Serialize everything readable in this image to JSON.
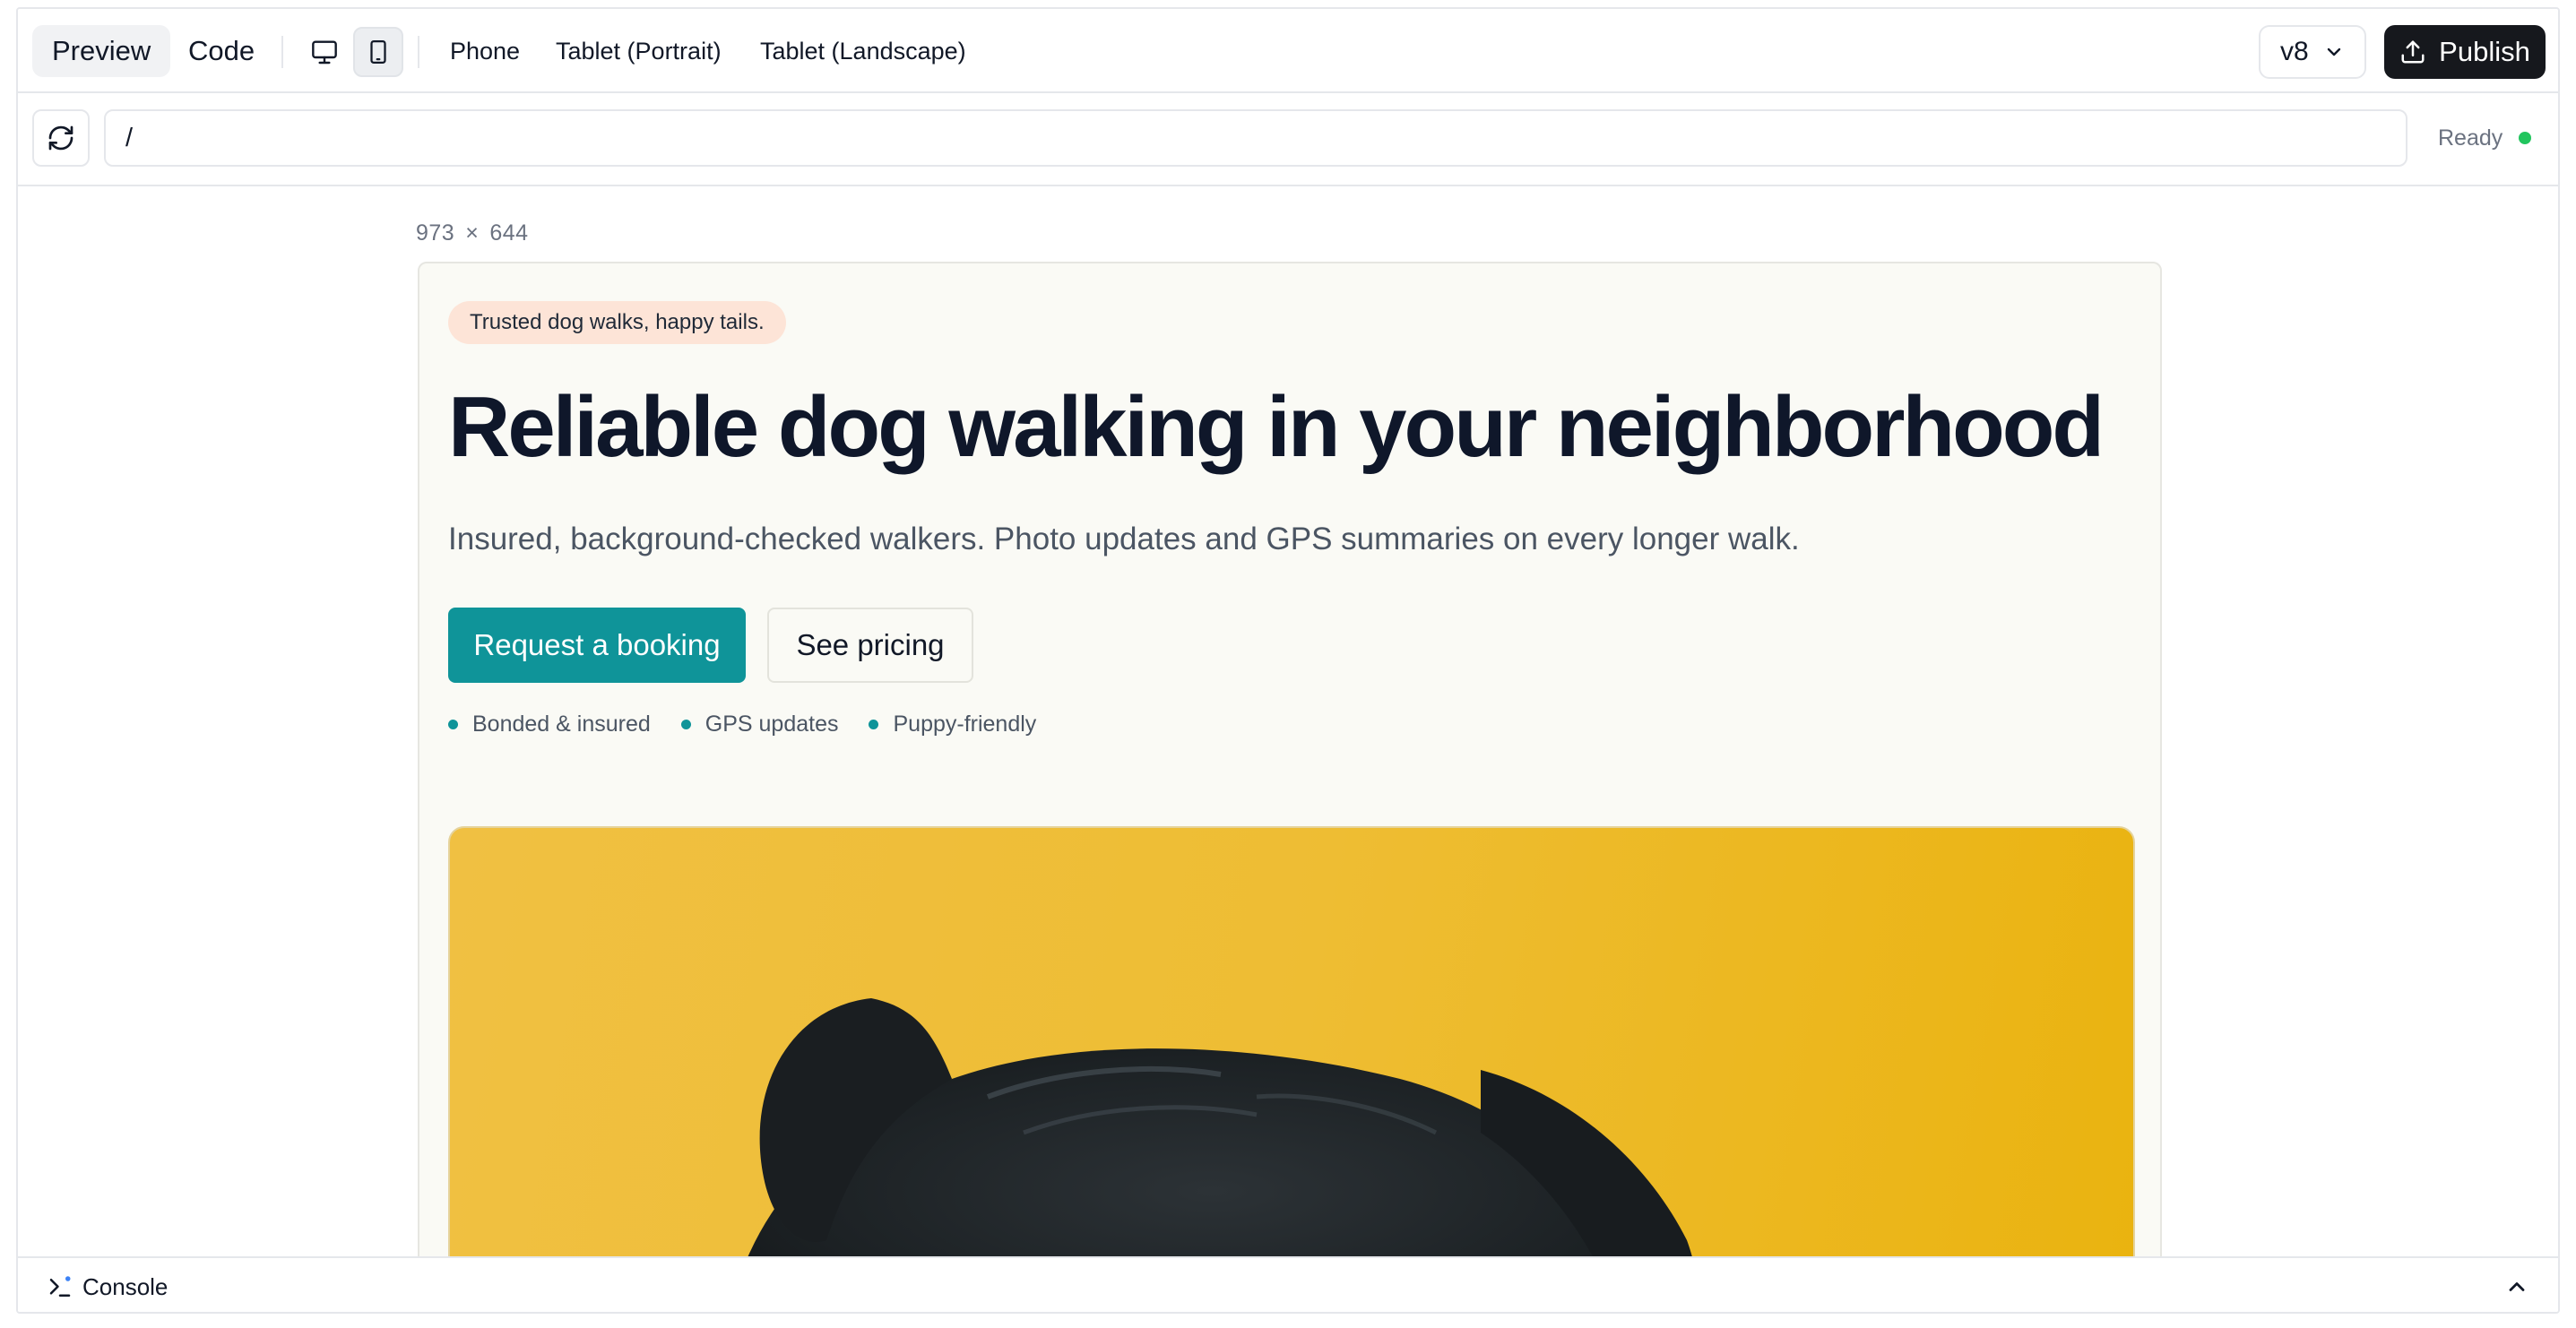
{
  "toolbar": {
    "preview_tab": "Preview",
    "code_tab": "Code",
    "device_tabs": [
      "Phone",
      "Tablet (Portrait)",
      "Tablet (Landscape)"
    ],
    "version": "v8",
    "publish_label": "Publish"
  },
  "address_bar": {
    "url": "/",
    "status": "Ready",
    "status_color": "#22c55e"
  },
  "canvas": {
    "width": "973",
    "times": "×",
    "height": "644"
  },
  "site": {
    "badge": "Trusted dog walks, happy tails.",
    "title": "Reliable dog walking in your neighborhood",
    "subtitle": "Insured, background-checked walkers. Photo updates and GPS summaries on every longer walk.",
    "primary_cta": "Request a booking",
    "secondary_cta": "See pricing",
    "features": [
      "Bonded & insured",
      "GPS updates",
      "Puppy-friendly"
    ],
    "accent_color": "#0f9499",
    "hero_image_subject": "black dog on yellow background"
  },
  "console": {
    "label": "Console"
  }
}
